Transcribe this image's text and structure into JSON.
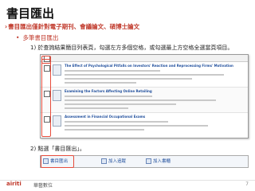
{
  "slide": {
    "title": "書目匯出",
    "bullet1": "書目匯出僅針對電子期刊、會議論文、碩博士論文",
    "bullet2": "多筆書目匯出",
    "step1": "1) 於查詢結果簡目列表頁，勾選左方多個空格，或勾選最上方空格全選當頁項目。",
    "step2": "2) 點選「書目匯出」。"
  },
  "results": [
    {
      "title": "The Effect of Psychological Pitfalls on Investors' Reaction and Reprocessing Firms' Motivation"
    },
    {
      "title": "Examining the Factors Affecting Online Retailing"
    },
    {
      "title": "Assessment in Financial Occupational Exams"
    }
  ],
  "toolbar": {
    "export": "書目匯出",
    "add_track": "加入追蹤",
    "add_folder": "加入書櫃"
  },
  "footer": {
    "logo": "airiti",
    "company": "華藝數位",
    "page": "7"
  },
  "colors": {
    "accent": "#c0392b",
    "highlight": "#e74c3c",
    "link": "#1f4e9c"
  }
}
